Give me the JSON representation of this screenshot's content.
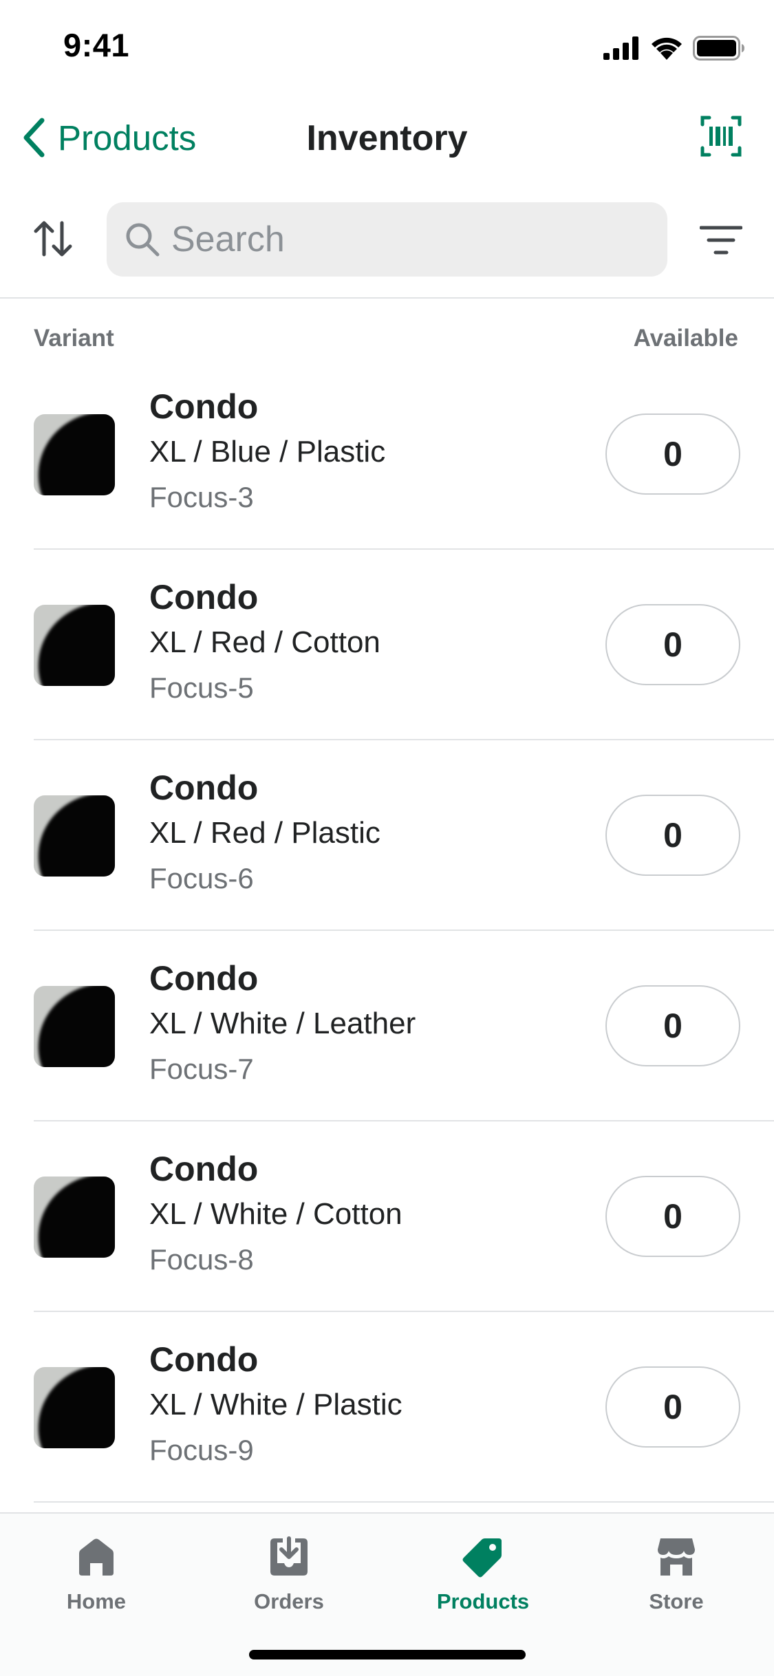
{
  "status_bar": {
    "time": "9:41"
  },
  "nav": {
    "back_label": "Products",
    "title": "Inventory"
  },
  "search": {
    "placeholder": "Search",
    "value": ""
  },
  "columns": {
    "variant": "Variant",
    "available": "Available"
  },
  "rows": [
    {
      "title": "Condo",
      "variant": "XL / Blue / Plastic",
      "sku": "Focus-3",
      "available": "0"
    },
    {
      "title": "Condo",
      "variant": "XL / Red / Cotton",
      "sku": "Focus-5",
      "available": "0"
    },
    {
      "title": "Condo",
      "variant": "XL / Red / Plastic",
      "sku": "Focus-6",
      "available": "0"
    },
    {
      "title": "Condo",
      "variant": "XL / White / Leather",
      "sku": "Focus-7",
      "available": "0"
    },
    {
      "title": "Condo",
      "variant": "XL / White / Cotton",
      "sku": "Focus-8",
      "available": "0"
    },
    {
      "title": "Condo",
      "variant": "XL / White / Plastic",
      "sku": "Focus-9",
      "available": "0"
    }
  ],
  "tabs": [
    {
      "label": "Home",
      "icon": "home-icon",
      "active": false
    },
    {
      "label": "Orders",
      "icon": "orders-icon",
      "active": false
    },
    {
      "label": "Products",
      "icon": "tag-icon",
      "active": true
    },
    {
      "label": "Store",
      "icon": "store-icon",
      "active": false
    }
  ],
  "colors": {
    "accent": "#008060",
    "secondary_text": "#6d7175",
    "divider": "#e1e3e5",
    "search_bg": "#ededed"
  }
}
